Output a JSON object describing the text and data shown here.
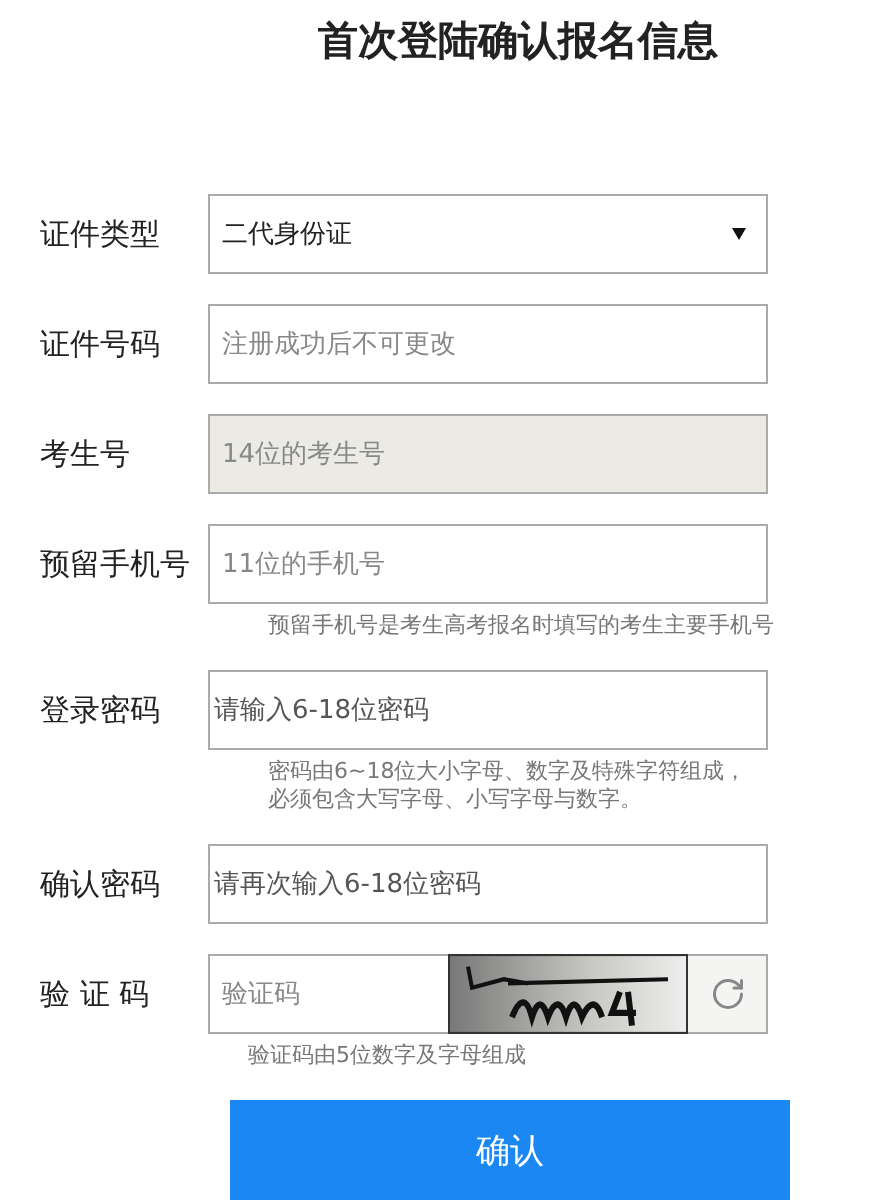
{
  "title": "首次登陆确认报名信息",
  "fields": [
    {
      "kind": "select",
      "label": "证件类型",
      "value": "二代身份证"
    },
    {
      "kind": "text",
      "label": "证件号码",
      "placeholder": "注册成功后不可更改",
      "disabled": false
    },
    {
      "kind": "text",
      "label": "考生号",
      "placeholder": "14位的考生号",
      "disabled": true
    },
    {
      "kind": "text",
      "label": "预留手机号",
      "placeholder": "11位的手机号",
      "disabled": false,
      "hint": [
        "预留手机号是考生高考报名时填写的考生主要手机号"
      ]
    },
    {
      "kind": "password",
      "label": "登录密码",
      "placeholder": "请输入6-18位密码",
      "disabled": false,
      "hint": [
        "密码由6~18位大小字母、数字及特殊字符组成，",
        "必须包含大写字母、小写字母与数字。"
      ]
    },
    {
      "kind": "password",
      "label": "确认密码",
      "placeholder": "请再次输入6-18位密码",
      "disabled": false
    },
    {
      "kind": "captcha",
      "label": "验 证 码",
      "placeholder": "验证码",
      "captcha": {
        "kind": "picture"
      },
      "hint": [
        "验证码由5位数字及字母组成"
      ]
    }
  ],
  "submit": "确认"
}
